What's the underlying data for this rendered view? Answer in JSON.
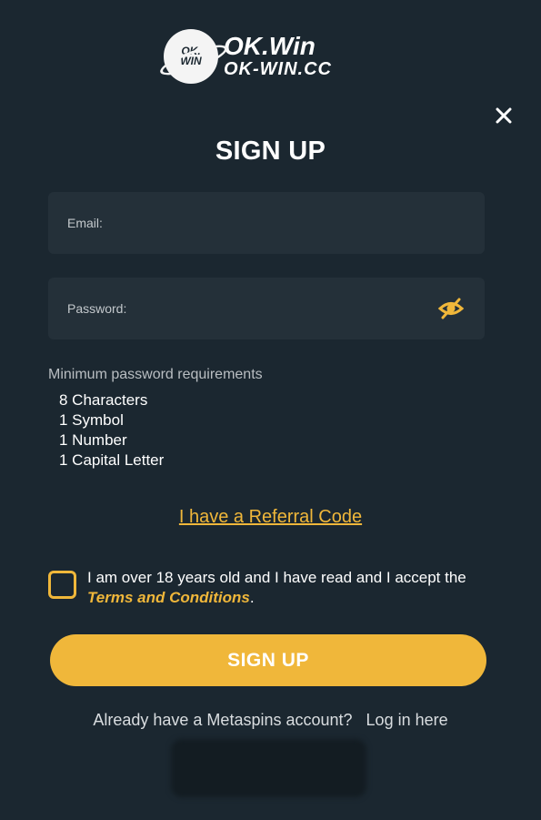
{
  "logo": {
    "badge_line1": "OK.",
    "badge_line2": "WIN",
    "title": "OK.Win",
    "subtitle": "OK-WIN.CC",
    "icon": "ok-win-logo"
  },
  "close_icon": "close-icon",
  "title": "SIGN UP",
  "form": {
    "email_placeholder": "Email:",
    "email_value": "",
    "password_placeholder": "Password:",
    "password_value": "",
    "password_toggle_icon": "eye-off-icon"
  },
  "requirements": {
    "title": "Minimum password requirements",
    "items": [
      "8 Characters",
      "1 Symbol",
      "1 Number",
      "1 Capital Letter"
    ]
  },
  "referral_link": "I have a Referral Code",
  "terms": {
    "text_before": "I am over 18 years old and I have read and I accept the ",
    "link": "Terms and Conditions",
    "text_after": ".",
    "checked": false
  },
  "signup_button": "SIGN UP",
  "login": {
    "prompt": "Already have a Metaspins account?",
    "link": "Log in here"
  },
  "colors": {
    "background": "#1b2730",
    "field": "#243039",
    "accent": "#f0b73a"
  }
}
